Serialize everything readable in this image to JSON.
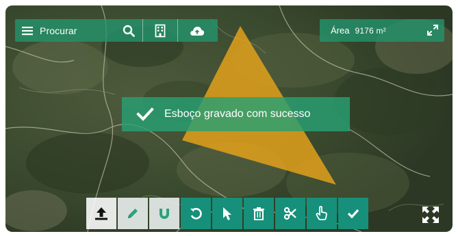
{
  "search": {
    "label": "Procurar"
  },
  "area": {
    "label": "Área",
    "value": "9176 m²"
  },
  "toast": {
    "message": "Esboço gravado com sucesso"
  },
  "toolbar": {
    "tools": [
      "upload-icon",
      "pencil-icon",
      "magnet-icon",
      "undo-icon",
      "cursor-icon",
      "trash-icon",
      "scissors-icon",
      "hand-pointer-icon",
      "check-icon"
    ]
  },
  "colors": {
    "accent": "#16907a",
    "polygon": "#e8a41a",
    "toolbar_light": "#ffffff"
  }
}
